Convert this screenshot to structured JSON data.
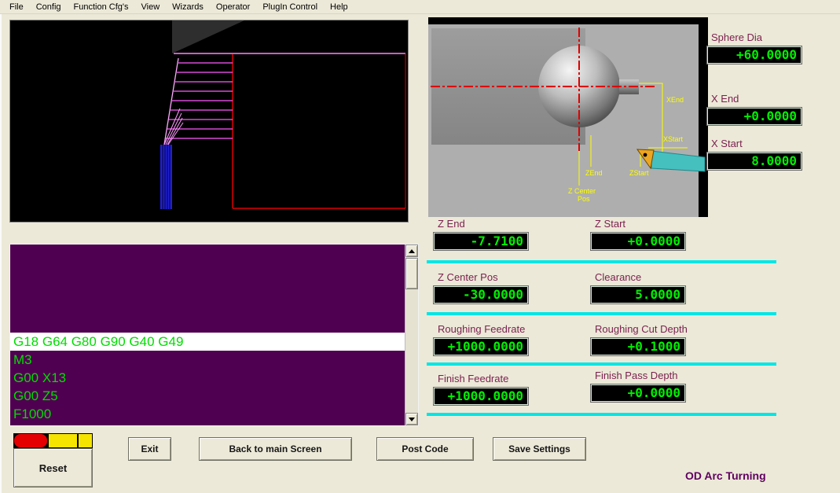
{
  "window": {
    "title": "OD Arc Turning"
  },
  "menu": {
    "items": [
      "File",
      "Config",
      "Function Cfg's",
      "View",
      "Wizards",
      "Operator",
      "PlugIn Control",
      "Help"
    ]
  },
  "gcode": {
    "current_line": "G18 G64 G80 G90 G40 G49",
    "lines": [
      "M3",
      "G00 X13",
      "G00 Z5",
      "F1000"
    ]
  },
  "diagram": {
    "labels": {
      "x_end": "XEnd",
      "x_start": "XStart",
      "z_end": "ZEnd",
      "z_start": "ZStart",
      "z_center_line1": "Z Center",
      "z_center_line2": "Pos"
    }
  },
  "fields": {
    "sphere_dia": {
      "label": "Sphere Dia",
      "value": "+60.0000"
    },
    "x_end": {
      "label": "X End",
      "value": "+0.0000"
    },
    "x_start": {
      "label": "X Start",
      "value": "8.0000"
    },
    "z_end": {
      "label": "Z End",
      "value": "-7.7100"
    },
    "z_start": {
      "label": "Z Start",
      "value": "+0.0000"
    },
    "z_center_pos": {
      "label": "Z Center Pos",
      "value": "-30.0000"
    },
    "clearance": {
      "label": "Clearance",
      "value": "5.0000"
    },
    "roughing_feedrate": {
      "label": "Roughing Feedrate",
      "value": "+1000.0000"
    },
    "roughing_cut_depth": {
      "label": "Roughing Cut Depth",
      "value": "+0.1000"
    },
    "finish_feedrate": {
      "label": "Finish Feedrate",
      "value": "+1000.0000"
    },
    "finish_pass_depth": {
      "label": "Finish Pass Depth",
      "value": "+0.0000"
    }
  },
  "buttons": {
    "exit": "Exit",
    "back_to_main": "Back to main Screen",
    "post_code": "Post Code",
    "save_settings": "Save Settings",
    "reset": "Reset"
  },
  "colors": {
    "led_green": "#00f000",
    "separator_cyan": "#00e6e6",
    "label_maroon": "#7b1f4e",
    "gcode_bg": "#500050",
    "gcode_green": "#00dd00",
    "title_purple": "#600060"
  }
}
